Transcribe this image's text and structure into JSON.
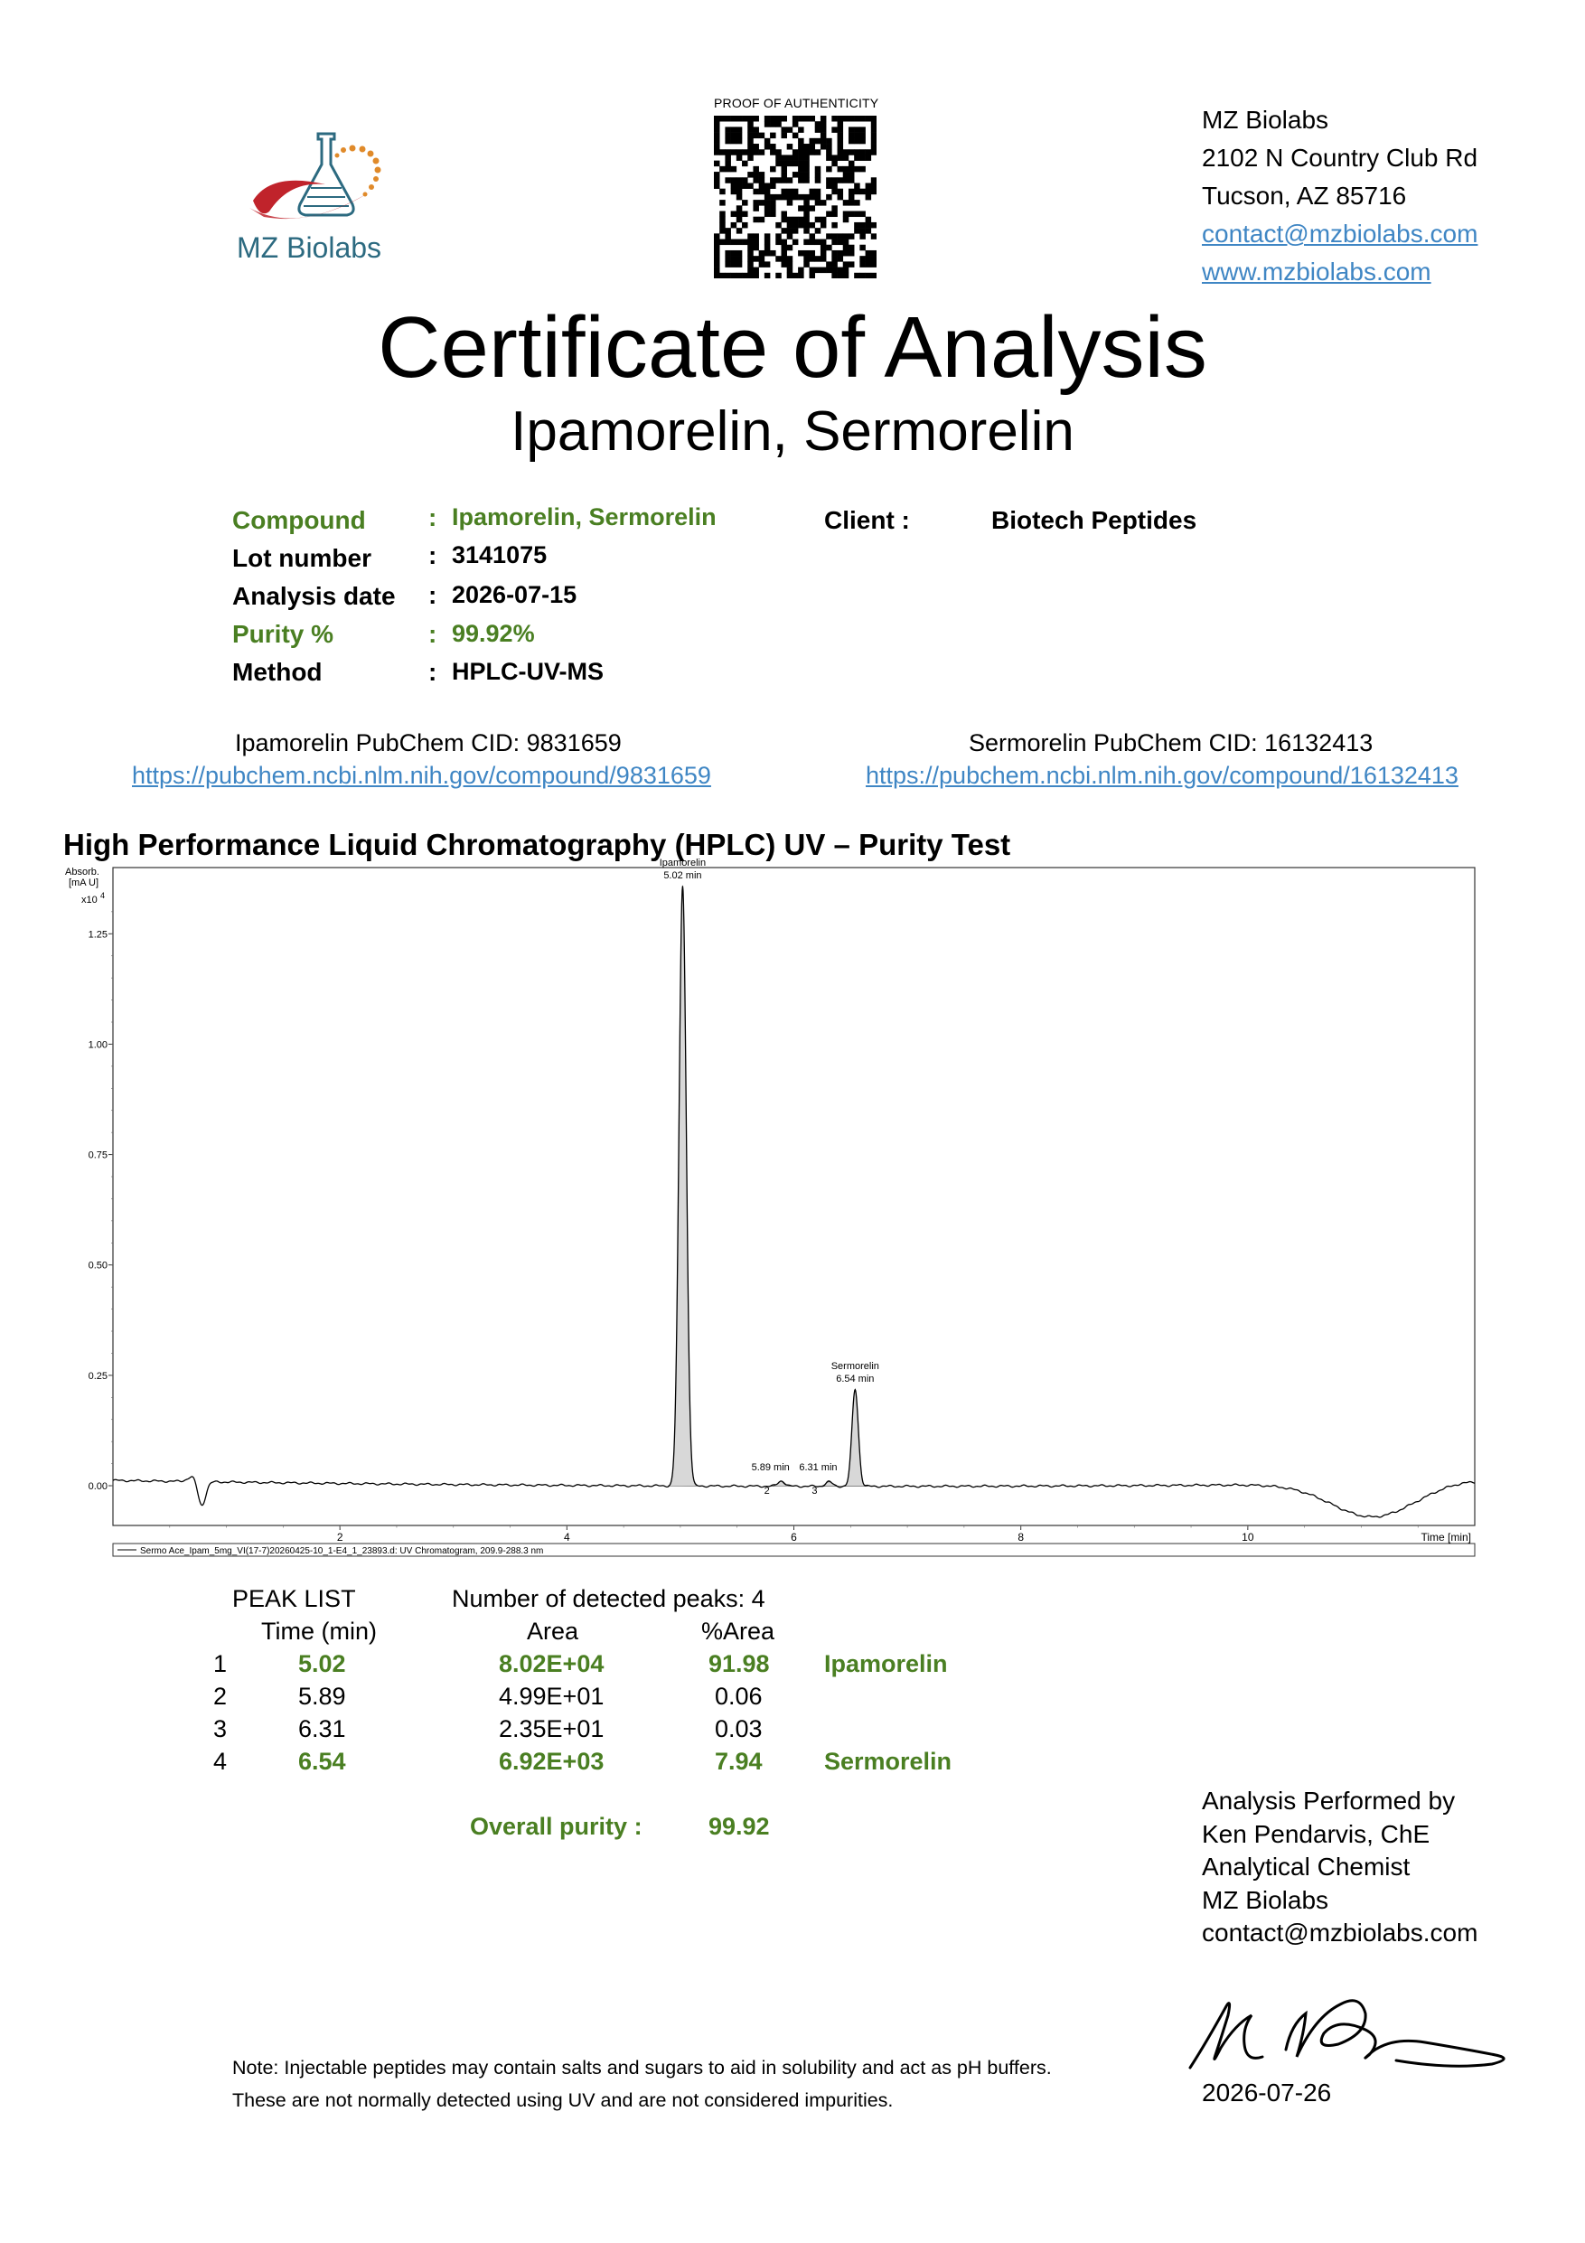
{
  "header": {
    "logo_name": "MZ Biolabs",
    "qr_caption": "PROOF OF AUTHENTICITY",
    "lab": {
      "name": "MZ Biolabs",
      "address1": "2102 N Country Club Rd",
      "address2": "Tucson, AZ 85716",
      "email": "contact@mzbiolabs.com",
      "website": "www.mzbiolabs.com"
    },
    "title": "Certificate of Analysis",
    "subtitle": "Ipamorelin, Sermorelin"
  },
  "info": {
    "colon": ":",
    "compound_label": "Compound",
    "compound_value": "Ipamorelin, Sermorelin",
    "lot_label": "Lot number",
    "lot_value": "3141075",
    "date_label": "Analysis date",
    "date_value": "2026-07-15",
    "purity_label": "Purity %",
    "purity_value": "99.92%",
    "method_label": "Method",
    "method_value": "HPLC-UV-MS",
    "client_label": "Client :",
    "client_value": "Biotech Peptides"
  },
  "pubchem": {
    "left_text": "Ipamorelin  PubChem CID: 9831659",
    "left_url": "https://pubchem.ncbi.nlm.nih.gov/compound/9831659",
    "right_text": "Sermorelin PubChem CID: 16132413",
    "right_url": "https://pubchem.ncbi.nlm.nih.gov/compound/16132413"
  },
  "hplc_title": "High Performance Liquid Chromatography (HPLC) UV – Purity Test",
  "chart_data": {
    "type": "line",
    "ylabel_lines": [
      "Absorb.",
      "[mA U]",
      "x10"
    ],
    "ylabel_exp": "4",
    "xlabel": "Time [min]",
    "xlim": [
      0,
      12
    ],
    "ylim": [
      -0.09,
      1.4
    ],
    "yticks": [
      0.0,
      0.25,
      0.5,
      0.75,
      1.0,
      1.25
    ],
    "ytick_labels": [
      "0.00",
      "0.25",
      "0.50",
      "0.75",
      "1.00",
      "1.25"
    ],
    "xticks": [
      2,
      4,
      6,
      8,
      10
    ],
    "xtick_labels": [
      "2",
      "4",
      "6",
      "8",
      "10"
    ],
    "legend": "Sermo Ace_Ipam_5mg_VI(17-7)20260425-10_1-E4_1_23893.d: UV Chromatogram, 209.9-288.3 nm",
    "peaks": [
      {
        "name": "Ipamorelin",
        "time": 5.02,
        "time_label": "5.02 min",
        "height": 1.36
      },
      {
        "name": "",
        "time": 5.89,
        "time_label": "5.89 min",
        "id": "2",
        "height": 0.012
      },
      {
        "name": "",
        "time": 6.31,
        "time_label": "6.31 min",
        "id": "3",
        "height": 0.01
      },
      {
        "name": "Sermorelin",
        "time": 6.54,
        "time_label": "6.54 min",
        "height": 0.22
      }
    ]
  },
  "peak_list": {
    "title": "PEAK LIST",
    "detected": "Number of detected peaks: 4",
    "col_time": "Time (min)",
    "col_area": "Area",
    "col_parea": "%Area",
    "rows": [
      {
        "n": "1",
        "time": "5.02",
        "area": "8.02E+04",
        "parea": "91.98",
        "name": "Ipamorelin"
      },
      {
        "n": "2",
        "time": "5.89",
        "area": "4.99E+01",
        "parea": "0.06",
        "name": ""
      },
      {
        "n": "3",
        "time": "6.31",
        "area": "2.35E+01",
        "parea": "0.03",
        "name": ""
      },
      {
        "n": "4",
        "time": "6.54",
        "area": "6.92E+03",
        "parea": "7.94",
        "name": "Sermorelin"
      }
    ],
    "overall_label": "Overall purity :",
    "overall_value": "99.92"
  },
  "analyst": {
    "line1": "Analysis Performed by",
    "line2": "Ken Pendarvis, ChE",
    "line3": "Analytical Chemist",
    "line4": "MZ Biolabs",
    "line5": "contact@mzbiolabs.com",
    "date": "2026-07-26"
  },
  "note": {
    "line1": "Note: Injectable peptides may contain salts and sugars to aid in solubility and act as pH buffers.",
    "line2": "These are not normally detected using UV and are not considered impurities."
  },
  "colors": {
    "green": "#4a7f22",
    "link": "#3f86c4",
    "logo_text": "#2c6a80",
    "logo_red": "#c0232b",
    "logo_orange": "#e08a2a",
    "peak_fill": "#d8d8d8"
  }
}
